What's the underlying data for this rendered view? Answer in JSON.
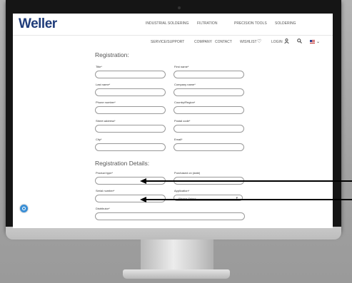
{
  "brand": {
    "logo": "Weller"
  },
  "top_nav": [
    "INDUSTRIAL SOLDERING",
    "FILTRATION",
    "PRECISION TOOLS",
    "SOLDERING"
  ],
  "sub_nav": [
    "SERVICE/SUPPORT",
    "COMPANY",
    "CONTACT",
    "WISHLIST",
    "LOGIN"
  ],
  "icons": [
    "heart-icon",
    "user-icon",
    "search-icon",
    "us-flag-icon",
    "chevron-down-icon",
    "chat-icon"
  ],
  "form": {
    "registration_heading": "Registration:",
    "title_label": "Title*",
    "first_name_label": "First name*",
    "last_name_label": "Last name*",
    "company_label": "Company name*",
    "phone_label": "Phone number*",
    "country_label": "Country/Region*",
    "street_label": "Street address*",
    "postal_label": "Postal code*",
    "city_label": "City*",
    "email_label": "Email*",
    "details_heading": "Registration Details:",
    "product_type_label": "Product type*",
    "purchased_on_label": "Purchased on (date)",
    "serial_label": "Serial number*",
    "application_label": "Application*",
    "application_value": "Please Select",
    "distributor_label": "Distributor*"
  },
  "colors": {
    "brand_blue": "#1f3c7a",
    "chat_blue": "#3a8fd6",
    "annotation_arrow": "#000000"
  }
}
